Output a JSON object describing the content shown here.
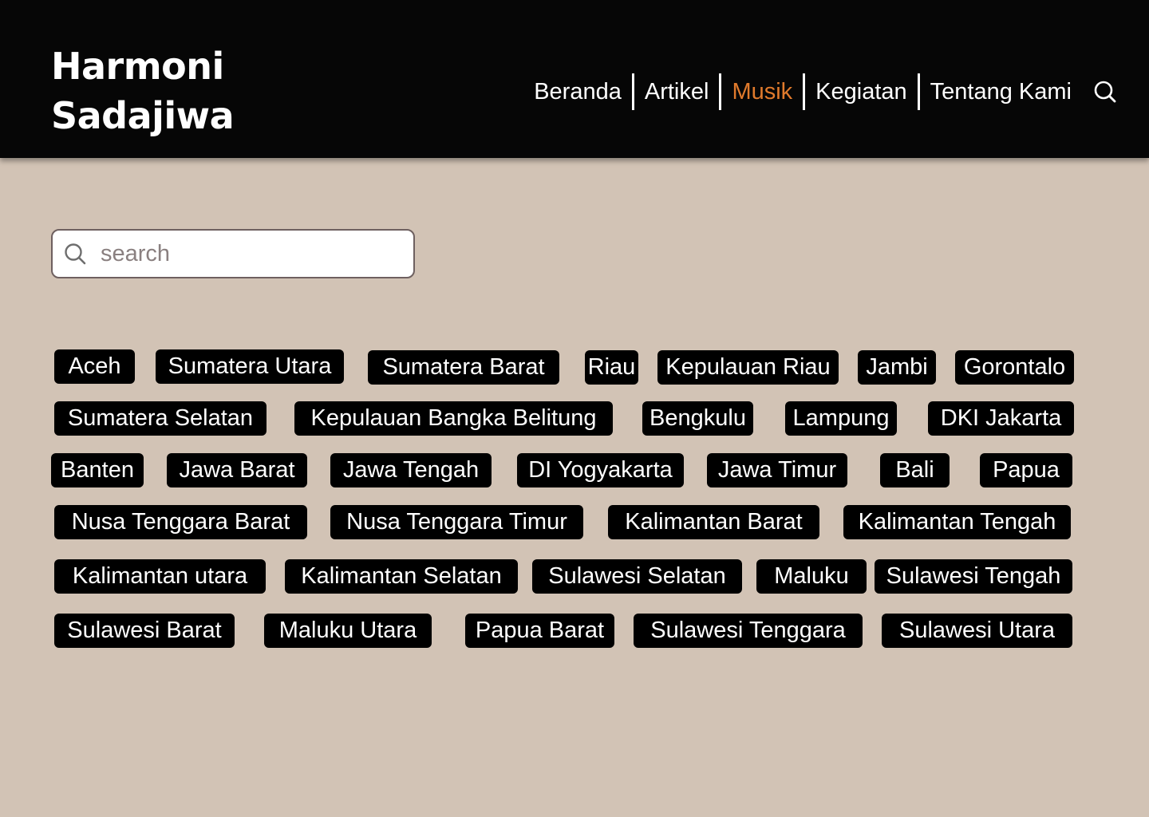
{
  "brand": {
    "line1": "Harmoni",
    "line2": "Sadajiwa"
  },
  "nav": {
    "items": [
      {
        "label": "Beranda"
      },
      {
        "label": "Artikel"
      },
      {
        "label": "Musik",
        "active": true
      },
      {
        "label": "Kegiatan"
      },
      {
        "label": "Tentang Kami"
      }
    ],
    "search_icon": "search-icon"
  },
  "search": {
    "placeholder": "search",
    "value": "",
    "icon": "search-icon"
  },
  "colors": {
    "header_bg": "#060606",
    "page_bg": "#d2c3b5",
    "accent": "#e07a2c",
    "tag_bg": "#000000"
  },
  "provinces": [
    "Aceh",
    "Sumatera Utara",
    "Sumatera Barat",
    "Riau",
    "Kepulauan Riau",
    "Jambi",
    "Gorontalo",
    "Sumatera Selatan",
    "Kepulauan Bangka Belitung",
    "Bengkulu",
    "Lampung",
    "DKI Jakarta",
    "Banten",
    "Jawa Barat",
    "Jawa Tengah",
    "DI Yogyakarta",
    "Jawa Timur",
    "Bali",
    "Papua",
    "Nusa Tenggara Barat",
    "Nusa Tenggara Timur",
    "Kalimantan Barat",
    "Kalimantan Tengah",
    "Kalimantan utara",
    "Kalimantan Selatan",
    "Sulawesi Selatan",
    "Maluku",
    "Sulawesi Tengah",
    "Sulawesi Barat",
    "Maluku Utara",
    "Papua Barat",
    "Sulawesi Tenggara",
    "Sulawesi Utara"
  ]
}
